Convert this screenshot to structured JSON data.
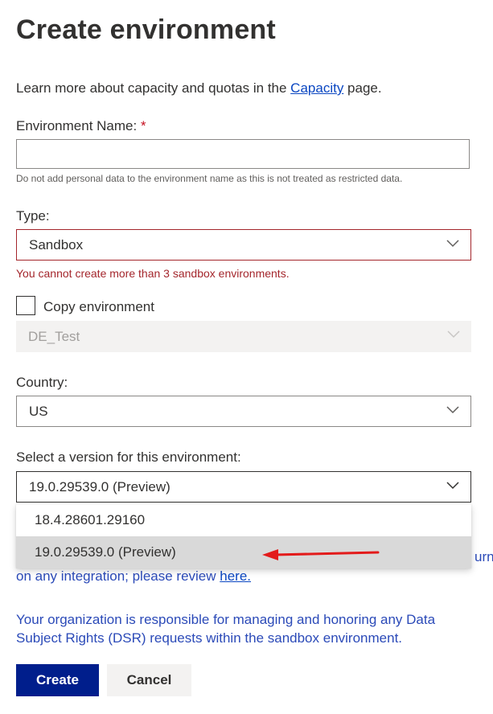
{
  "title": "Create environment",
  "intro": {
    "text_before": "Learn more about capacity and quotas in the ",
    "link": "Capacity",
    "text_after": " page."
  },
  "env_name": {
    "label": "Environment Name:",
    "required_mark": "*",
    "value": "",
    "hint": "Do not add personal data to the environment name as this is not treated as restricted data."
  },
  "type": {
    "label": "Type:",
    "value": "Sandbox",
    "error": "You cannot create more than 3 sandbox environments."
  },
  "copy_env": {
    "label": "Copy environment",
    "checked": false,
    "source_value": "DE_Test"
  },
  "country": {
    "label": "Country:",
    "value": "US"
  },
  "version": {
    "label": "Select a version for this environment:",
    "value": "19.0.29539.0 (Preview)",
    "options": [
      "18.4.28601.29160",
      "19.0.29539.0 (Preview)"
    ],
    "selected_index": 1
  },
  "notice": {
    "partial_right": "urn",
    "line2_before": "on any integration; please review ",
    "line2_link": "here."
  },
  "dsr_text": "Your organization is responsible for managing and honoring any Data Subject Rights (DSR) requests within the sandbox environment.",
  "buttons": {
    "create": "Create",
    "cancel": "Cancel"
  },
  "colors": {
    "primary": "#001e8c",
    "error": "#a4262c",
    "link": "#0b47c2",
    "info_text": "#2b4ab8",
    "annotation_arrow": "#e31b1b"
  }
}
